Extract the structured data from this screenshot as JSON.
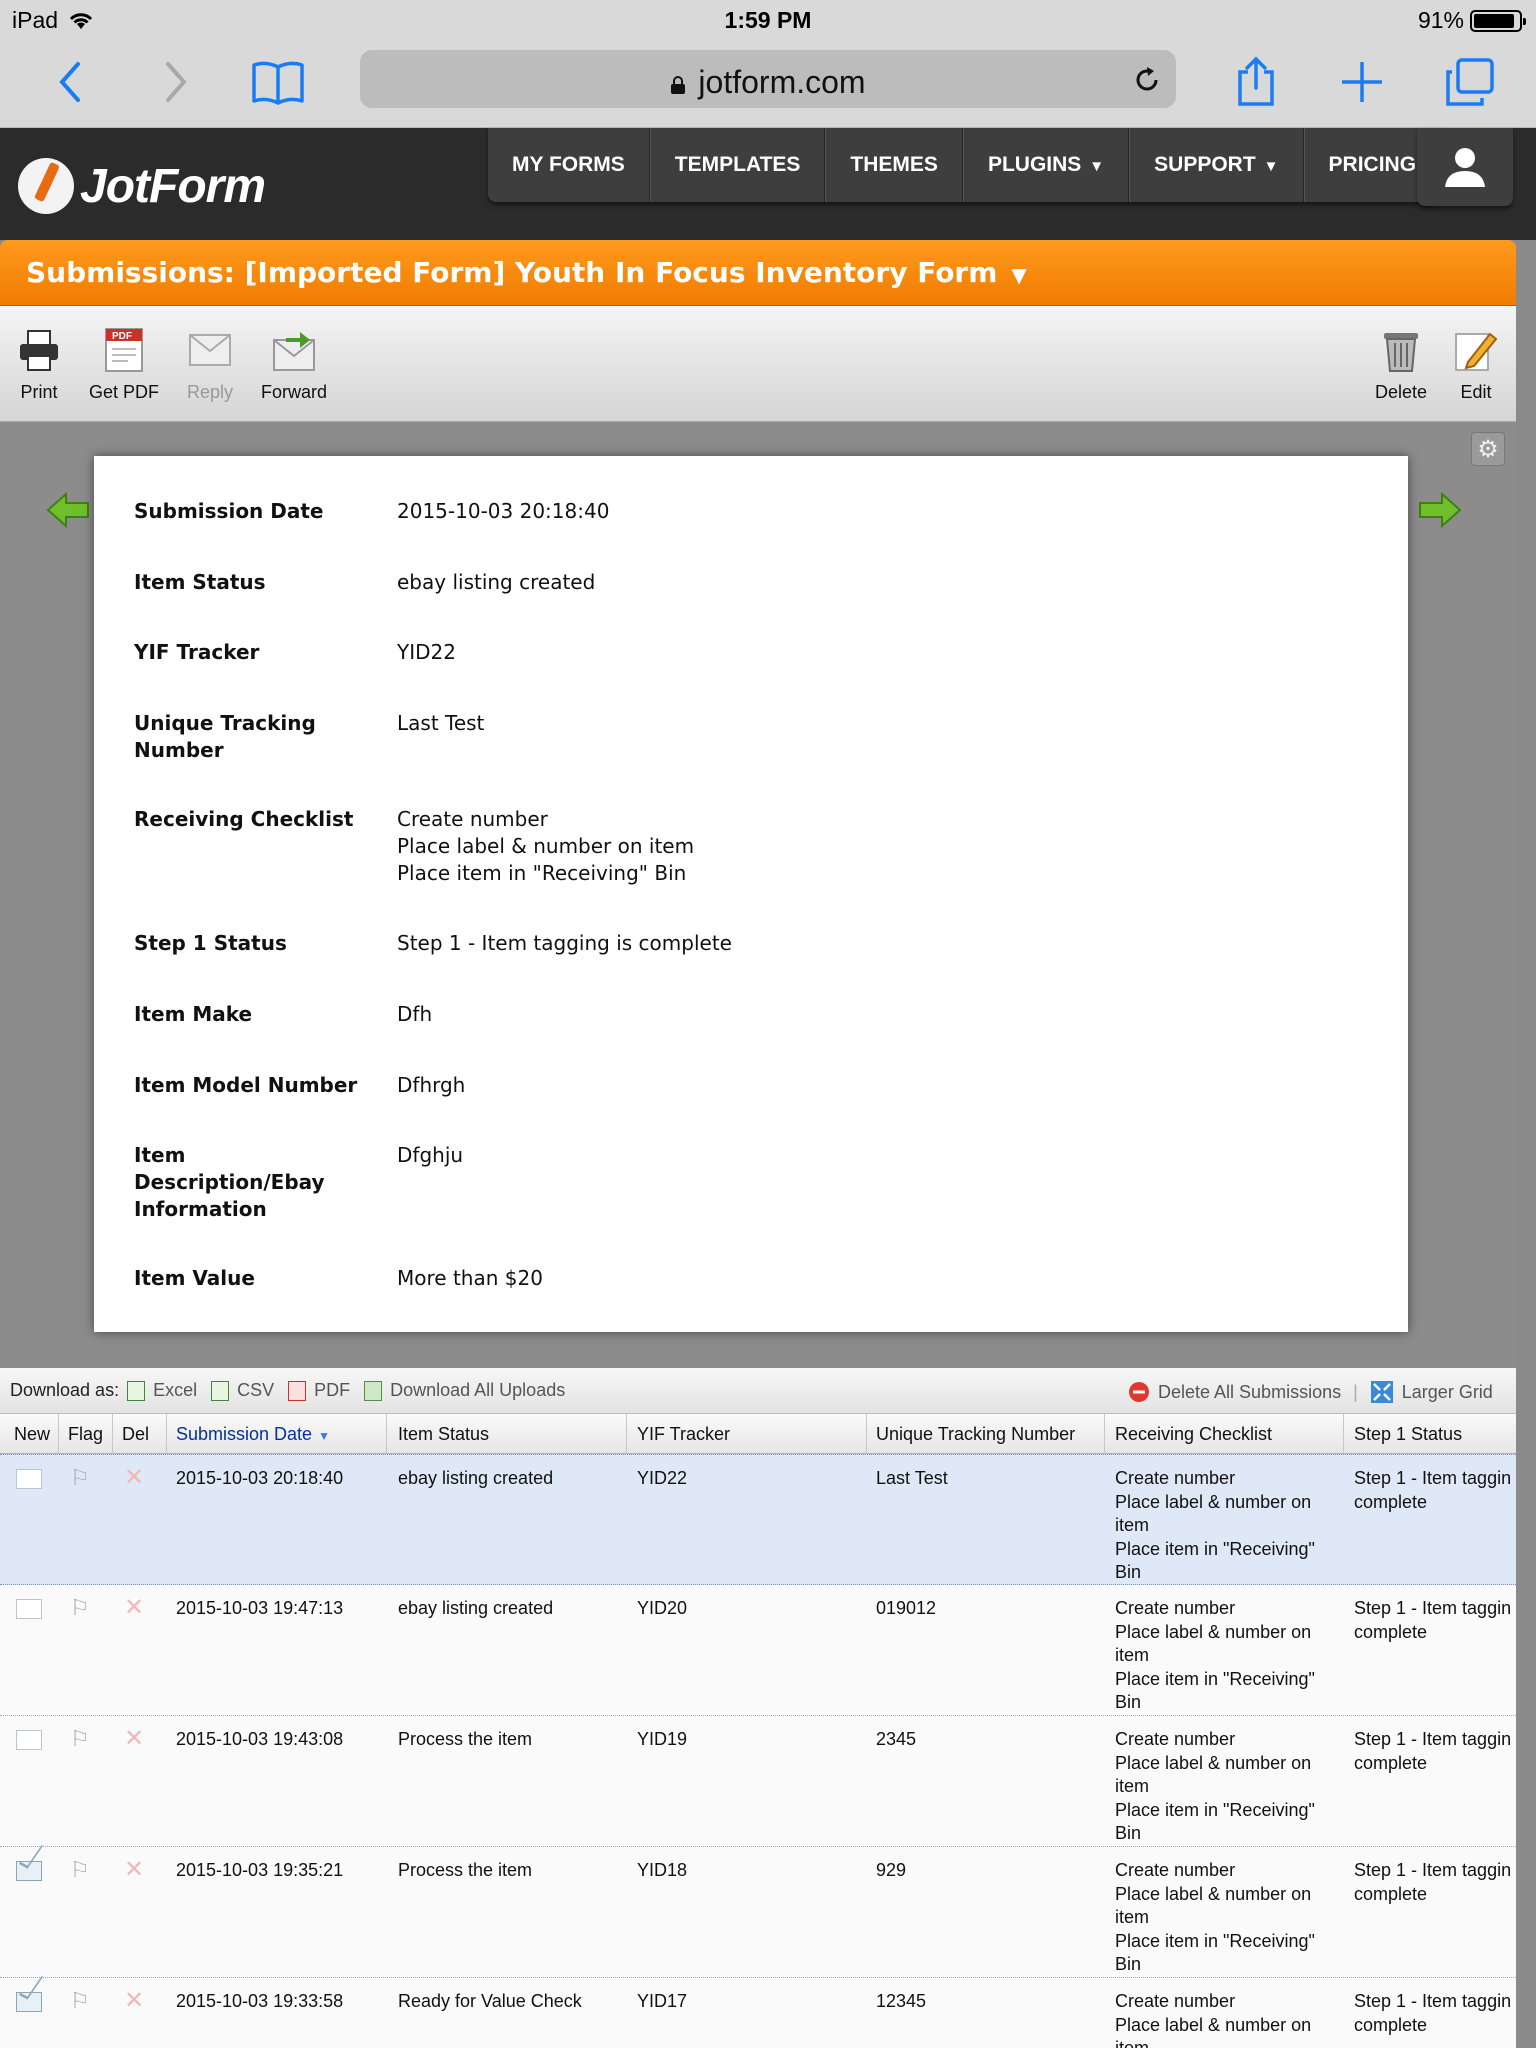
{
  "status_bar": {
    "device": "iPad",
    "time": "1:59 PM",
    "battery": "91%",
    "battery_level": 0.91
  },
  "browser": {
    "url": "jotform.com"
  },
  "brand": {
    "name": "JotForm",
    "accent": "#f08a00"
  },
  "nav": {
    "items": [
      "MY FORMS",
      "TEMPLATES",
      "THEMES",
      "PLUGINS",
      "SUPPORT",
      "PRICING"
    ],
    "dropdown_caret": "▼"
  },
  "submission_bar": {
    "title": "Submissions: [Imported Form] Youth In Focus Inventory Form"
  },
  "actions": {
    "print": "Print",
    "get_pdf": "Get PDF",
    "reply": "Reply",
    "forward": "Forward",
    "delete": "Delete",
    "edit": "Edit"
  },
  "detail": {
    "fields": [
      {
        "label": "Submission Date",
        "value": "2015-10-03 20:18:40"
      },
      {
        "label": "Item Status",
        "value": "ebay listing created"
      },
      {
        "label": "YIF Tracker",
        "value": "YID22"
      },
      {
        "label": "Unique Tracking\nNumber",
        "value": "Last Test"
      },
      {
        "label": "Receiving Checklist",
        "value": "Create number\nPlace label & number on item\nPlace item in \"Receiving\" Bin"
      },
      {
        "label": "Step 1 Status",
        "value": "Step 1 - Item tagging is complete"
      },
      {
        "label": "Item Make",
        "value": "Dfh"
      },
      {
        "label": "Item Model Number",
        "value": "Dfhrgh"
      },
      {
        "label": "Item\nDescription/Ebay\nInformation",
        "value": "Dfghju"
      },
      {
        "label": "Item Value",
        "value": "More than $20"
      }
    ]
  },
  "download_bar": {
    "label": "Download as:",
    "excel": "Excel",
    "csv": "CSV",
    "pdf": "PDF",
    "uploads": "Download All Uploads",
    "delete_all": "Delete All Submissions",
    "larger_grid": "Larger Grid"
  },
  "grid": {
    "columns": [
      "New",
      "Flag",
      "Del",
      "Submission Date",
      "Item Status",
      "YIF Tracker",
      "Unique Tracking Number",
      "Receiving Checklist",
      "Step 1 Status"
    ],
    "rows": [
      {
        "date": "2015-10-03 20:18:40",
        "status": "ebay listing created",
        "tracker": "YID22",
        "unique": "Last Test",
        "checklist": "Create number\nPlace label & number on\nitem\nPlace item in \"Receiving\"\nBin",
        "step1": "Step 1 - Item taggin\ncomplete",
        "unread": false,
        "selected": true
      },
      {
        "date": "2015-10-03 19:47:13",
        "status": "ebay listing created",
        "tracker": "YID20",
        "unique": "019012",
        "checklist": "Create number\nPlace label & number on\nitem\nPlace item in \"Receiving\"\nBin",
        "step1": "Step 1 - Item taggin\ncomplete",
        "unread": false,
        "selected": false
      },
      {
        "date": "2015-10-03 19:43:08",
        "status": "Process the item",
        "tracker": "YID19",
        "unique": "2345",
        "checklist": "Create number\nPlace label & number on\nitem\nPlace item in \"Receiving\"\nBin",
        "step1": "Step 1 - Item taggin\ncomplete",
        "unread": false,
        "selected": false
      },
      {
        "date": "2015-10-03 19:35:21",
        "status": "Process the item",
        "tracker": "YID18",
        "unique": "929",
        "checklist": "Create number\nPlace label & number on\nitem\nPlace item in \"Receiving\"\nBin",
        "step1": "Step 1 - Item taggin\ncomplete",
        "unread": true,
        "selected": false
      },
      {
        "date": "2015-10-03 19:33:58",
        "status": "Ready for Value Check",
        "tracker": "YID17",
        "unique": "12345",
        "checklist": "Create number\nPlace label & number on\nitem",
        "step1": "Step 1 - Item taggin\ncomplete",
        "unread": true,
        "selected": false
      }
    ]
  }
}
